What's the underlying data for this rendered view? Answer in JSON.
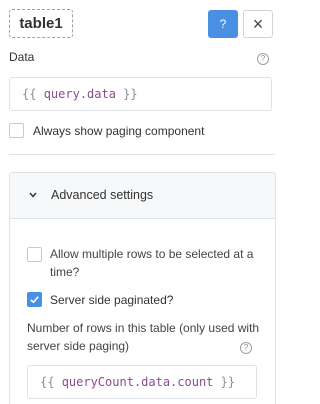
{
  "header": {
    "component_name": "table1",
    "help_label": "?",
    "close_label": "×"
  },
  "data_field": {
    "label": "Data",
    "help_icon": "question-circle-icon",
    "open_brace": "{{",
    "code_keyword": "query",
    "code_rest": ".data",
    "close_brace": "}}"
  },
  "paging": {
    "always_show_label": "Always show paging component",
    "always_show_checked": false
  },
  "advanced": {
    "title": "Advanced settings",
    "chevron_icon": "chevron-down-icon",
    "multi_select_line1": "Allow multiple rows to be selected at a",
    "multi_select_line2": "time?",
    "multi_select_checked": false,
    "server_paginated_label": "Server side paginated?",
    "server_paginated_checked": true,
    "rows_label_line1": "Number of rows in this table (only used with",
    "rows_label_line2": "server side paging)",
    "rows_open_brace": "{{",
    "rows_keyword": "queryCount",
    "rows_rest": ".data.count",
    "rows_close_brace": "}}"
  },
  "colors": {
    "accent": "#4a90e2",
    "code_keyword": "#8e4b8e"
  }
}
